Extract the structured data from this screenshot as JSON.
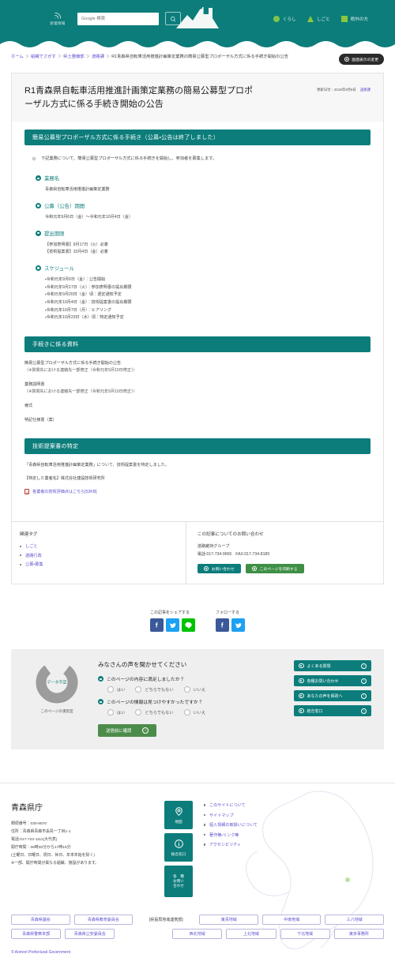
{
  "header": {
    "rss_label": "新着情報",
    "search_placeholder": "Google 検索",
    "search_value": "",
    "search_icon": "search-icon",
    "logo_name": "aomori-prefecture-logo",
    "nav": [
      {
        "label": "くらし",
        "shape": "circle"
      },
      {
        "label": "しごと",
        "shape": "triangle"
      },
      {
        "label": "県外の方",
        "shape": "square"
      }
    ]
  },
  "breadcrumb": {
    "items": [
      "ホーム",
      "組織でさがす",
      "県土整備部",
      "道路課"
    ],
    "current": "R1青森県自転車活用推進計画策定業務の簡易公募型プロポーザル方式に係る手続き開始の公告",
    "separator": "＞",
    "display_button": "画面表示の変更"
  },
  "article": {
    "title": "R1青森県自転車活用推進計画策定業務の簡易公募型プロポーザル方式に係る手続き開始の公告",
    "updated_label": "更新日付：2019年9月6日",
    "department": "道路課",
    "section1": {
      "heading": "簡易公募型プロポーザル方式に係る手続き（公募・公告は終了しました）",
      "intro": "下記業務について、簡易公募型プロポーザル方式に係る手続きを開始し、参加者を募集します。",
      "blocks": [
        {
          "label": "業務名",
          "lines": [
            "青森県自転車活用推進計画策定業務"
          ]
        },
        {
          "label": "公募（公告）期間",
          "lines": [
            "令和元年9月6日（金）～令和元年10月4日（金）"
          ]
        },
        {
          "label": "提出期限",
          "lines": [
            "【参加表明書】9月17日（火）必着",
            "【技術提案書】10月4日（金）必着"
          ]
        },
        {
          "label": "スケジュール",
          "lines": [
            "・令和元年9月6日（金）：公告開始",
            "・令和元年9月17日（火）：参加表明書の提出期限",
            "・令和元年9月20日（金）頃：選定通知予定",
            "・令和元年10月4日（金）：技術提案書の提出期限",
            "・令和元年10月7日（月）：ヒアリング",
            "・令和元年10月23日（水）頃：特定通知予定"
          ]
        }
      ]
    },
    "section2": {
      "heading": "手続きに係る資料",
      "documents": [
        {
          "title": "簡易公募型プロポーザル方式に係る手続き開始の公告",
          "note": "（※質問先における連絡先一部修正（令和元年9月10日修正））"
        },
        {
          "title": "業務説明書",
          "note": "（※質問先における連絡先一部修正（令和元年9月10日修正））"
        },
        {
          "title": "様式",
          "note": ""
        },
        {
          "title": "特記仕様書（案）",
          "note": ""
        }
      ]
    },
    "section3": {
      "heading": "技術提案書の特定",
      "line1": "「青森県自転車活用推進計画策定業務」について、技術提案書を特定しました。",
      "line2": "【特定した業者名】株式会社建設技術研究所",
      "pdf_link": "各業者の技術評価点はこちら[52KB]",
      "pdf_icon": "pdf-icon"
    },
    "tags": {
      "heading": "関連タグ",
      "items": [
        "しごと",
        "道路行政",
        "公募・募集"
      ]
    },
    "contact": {
      "heading": "この記事についてのお問い合わせ",
      "group": "道路維持グループ",
      "phone": "電話:017-734-9656　FAX:017-734-8189",
      "buttons": [
        {
          "label": "お問い合わせ",
          "color": "teal"
        },
        {
          "label": "このページを印刷する",
          "color": "green"
        }
      ]
    }
  },
  "share": {
    "groups": [
      {
        "label": "この記事をシェアする",
        "icons": [
          "facebook-icon",
          "twitter-icon",
          "line-icon"
        ]
      },
      {
        "label": "フォローする",
        "icons": [
          "facebook-icon",
          "twitter-icon"
        ]
      }
    ]
  },
  "survey": {
    "donut_label": "データ不足",
    "donut_caption": "このページの満足度",
    "heading": "みなさんの声を聞かせてください",
    "questions": [
      {
        "text": "このページの内容に満足しましたか？",
        "options": [
          "はい",
          "どちらでもない",
          "いいえ"
        ]
      },
      {
        "text": "このページの情報は見つけやすかったですか？",
        "options": [
          "はい",
          "どちらでもない",
          "いいえ"
        ]
      }
    ],
    "submit_label": "送信前に確認",
    "side_buttons": [
      "よくある質問",
      "各種お問い合わせ",
      "あなたの声を県政へ",
      "総合窓口"
    ]
  },
  "footer": {
    "org_name": "青森県庁",
    "address_lines": [
      "郵便番号：030-8570",
      "住所：青森県青森市長島一丁目1-1",
      "電話:017-722-1111(大代表)",
      "開庁時間：08時30分から17時15分",
      "(土曜日、日曜日、祝日、休日、年末年始を除く)",
      "※一部、開庁時間が異なる組織、施設があります。"
    ],
    "icon_buttons": [
      {
        "label": "地図",
        "icon": "map-pin-icon"
      },
      {
        "label": "総合窓口",
        "icon": "info-icon"
      },
      {
        "label": "各　種\nお問い\n合わせ",
        "icon": "inquiry-icon"
      }
    ],
    "links": [
      "このサイトについて",
      "サイトマップ",
      "個人情報の取扱いについて",
      "著作権・リンク等",
      "アクセシビリティ"
    ],
    "org_buttons_row1": [
      "青森県議会",
      "青森県教育委員会"
    ],
    "org_buttons_row2": [
      "青森県警察本部",
      "青森県公安委員会"
    ],
    "region_note": "[県民局地域連携部]",
    "region_row1": [
      "東青地域",
      "中南地域",
      "三八地域"
    ],
    "region_row2": [
      "西北地域",
      "上北地域",
      "下北地域",
      "東京事務所"
    ],
    "copyright": "© Aomori Prefectural Government"
  },
  "colors": {
    "brand_teal": "#0c7d7b",
    "accent_green": "#8cc63f",
    "link_purple": "#5a4fcf",
    "button_green": "#3f8f47"
  }
}
